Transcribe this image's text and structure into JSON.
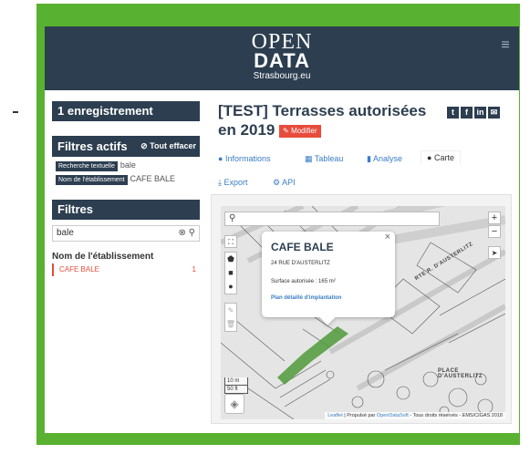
{
  "header": {
    "logo_line1": "OPEN",
    "logo_line2": "DATA",
    "logo_line3": "Strasbourg.eu",
    "menu_icon": "hamburger-icon"
  },
  "sidebar": {
    "records": "1 enregistrement",
    "active_filters_title": "Filtres actifs",
    "clear_all": "Tout effacer",
    "active_filters": [
      {
        "tag": "Recherche textuelle",
        "value": "bale"
      },
      {
        "tag": "Nom de l'établissement",
        "value": "CAFE BALE"
      }
    ],
    "filters_title": "Filtres",
    "search_value": "bale",
    "facet_title": "Nom de l'établissement",
    "facet_item": {
      "label": "CAFE BALE",
      "count": "1"
    }
  },
  "dataset": {
    "title": "[TEST] Terrasses autorisées en 2019",
    "edit_label": "Modifier",
    "social": [
      "t",
      "f",
      "in",
      "✉"
    ]
  },
  "tabs": {
    "informations": "Informations",
    "tableau": "Tableau",
    "analyse": "Analyse",
    "carte": "Carte",
    "export": "Export",
    "api": "API"
  },
  "map": {
    "search_placeholder": "",
    "zoom_in": "+",
    "zoom_out": "−",
    "scale_m": "10 m",
    "scale_ft": "50 ft",
    "street1": "RTE R. D'AUSTERLITZ",
    "street2": "PLACE D'AUSTERLITZ",
    "attribution_leaflet": "Leaflet",
    "attribution_mid": " | Propulsé par ",
    "attribution_ods": "OpenDataSoft",
    "attribution_end": " - Tous droits réservés - EMS/CIGAS 2018",
    "popup": {
      "name": "CAFE BALE",
      "address": "24 RUE D'AUSTERLITZ",
      "surface": "Surface autorisée : 165 m²",
      "plan_link": "Plan détaillé d'implantation",
      "close": "×"
    }
  },
  "colors": {
    "frame": "#58b130",
    "header": "#2c3e50",
    "accent_red": "#e74c3c",
    "link_blue": "#3a7dc4"
  }
}
